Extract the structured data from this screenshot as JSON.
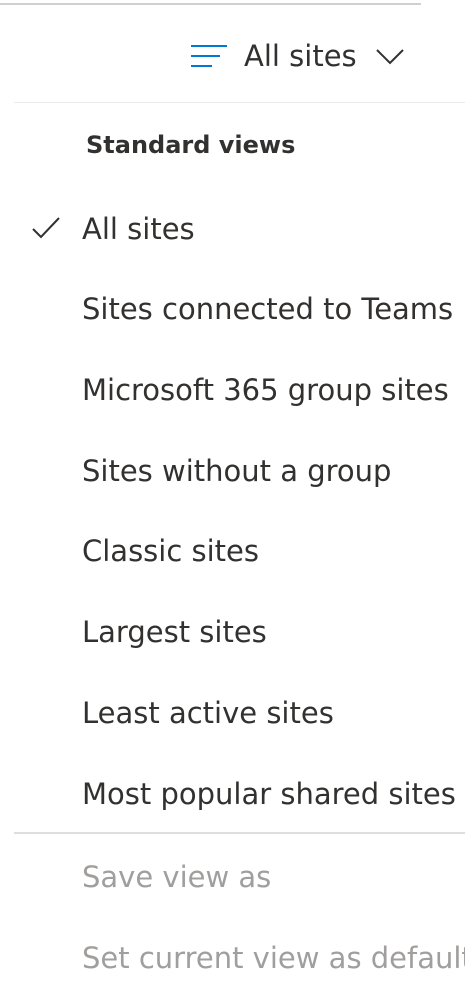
{
  "view_selector": {
    "label": "All sites",
    "icon": "filter-lines-icon",
    "accent_color": "#0078d4"
  },
  "menu": {
    "section_header": "Standard views",
    "items": [
      {
        "label": "All sites",
        "checked": true
      },
      {
        "label": "Sites connected to Teams",
        "checked": false
      },
      {
        "label": "Microsoft 365 group sites",
        "checked": false
      },
      {
        "label": "Sites without a group",
        "checked": false
      },
      {
        "label": "Classic sites",
        "checked": false
      },
      {
        "label": "Largest sites",
        "checked": false
      },
      {
        "label": "Least active sites",
        "checked": false
      },
      {
        "label": "Most popular shared sites",
        "checked": false
      }
    ],
    "actions": [
      {
        "label": "Save view as",
        "enabled": false
      },
      {
        "label": "Set current view as default",
        "enabled": false
      }
    ]
  }
}
